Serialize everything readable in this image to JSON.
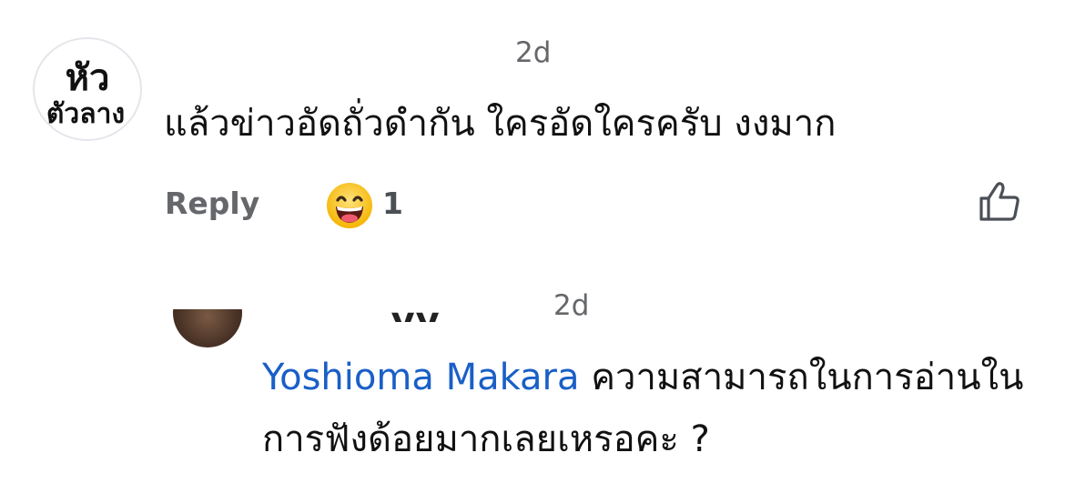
{
  "comment1": {
    "avatar_icon": "page-logo-avatar",
    "avatar_text_top": "หัว",
    "avatar_text_bottom": "ตัวลาง",
    "time": "2d",
    "text": "แล้วข่าวอัดถั่วดำกัน ใครอัดใครครับ งงมาก",
    "reply_label": "Reply",
    "reaction_icon": "grinning-face-emoji",
    "reaction_count": "1",
    "like_icon": "thumbs-up-outline-icon"
  },
  "comment2": {
    "avatar_icon": "user-photo-avatar",
    "author_name_partial": "........yy ..",
    "time": "2d",
    "mention": "Yoshioma Makara",
    "text": "ความสามารถในการอ่านในการฟังด้อยมากเลยเหรอคะ ?"
  }
}
